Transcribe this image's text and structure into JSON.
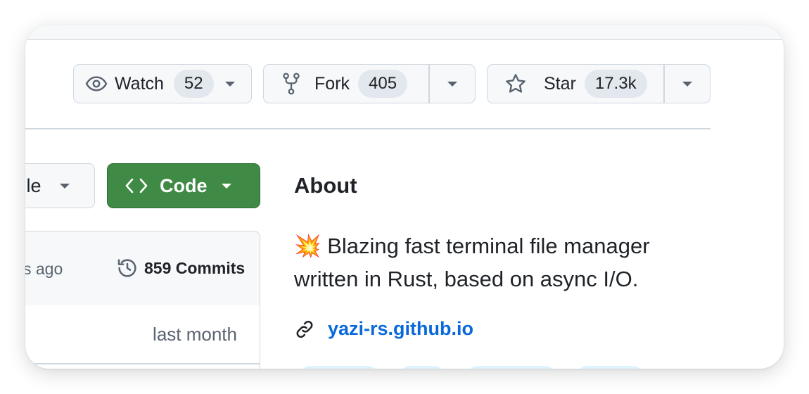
{
  "repo_actions": {
    "watch": {
      "label": "Watch",
      "count": "52"
    },
    "fork": {
      "label": "Fork",
      "count": "405"
    },
    "star": {
      "label": "Star",
      "count": "17.3k"
    }
  },
  "toolbar": {
    "file_label": "File",
    "code_label": "Code"
  },
  "commit_bar": {
    "time_partial": "s ago",
    "commits_label": "859 Commits"
  },
  "file_rows": [
    {
      "time": "last month"
    }
  ],
  "about": {
    "title": "About",
    "emoji": "💥",
    "description": " Blazing fast terminal file manager written in Rust, based on async I/O.",
    "link": "yazi-rs.github.io"
  },
  "colors": {
    "accent_green": "#3f8a45",
    "link_blue": "#0969da",
    "border": "#d0d7de",
    "topic_bg": "#ddf4ff"
  }
}
